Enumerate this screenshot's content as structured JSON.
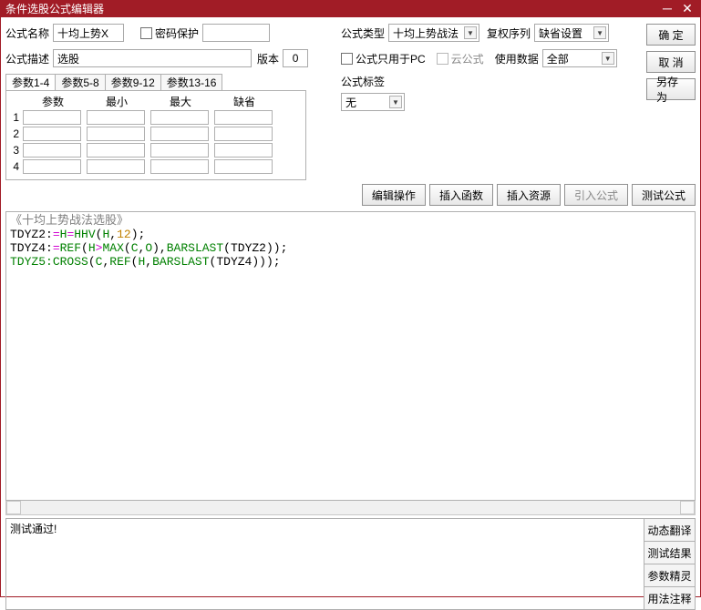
{
  "title": "条件选股公式编辑器",
  "labels": {
    "name": "公式名称",
    "pwd": "密码保护",
    "desc": "公式描述",
    "ver": "版本",
    "type": "公式类型",
    "fq": "复权序列",
    "pconly": "公式只用于PC",
    "cloud": "云公式",
    "usedata": "使用数据",
    "tag": "公式标签"
  },
  "vals": {
    "name": "十均上势X",
    "desc": "选股",
    "ver": "0",
    "type": "十均上势战法",
    "fq": "缺省设置",
    "usedata": "全部",
    "tag": "无"
  },
  "buttons": {
    "ok": "确  定",
    "cancel": "取  消",
    "saveas": "另存为",
    "editop": "编辑操作",
    "insfunc": "插入函数",
    "insres": "插入资源",
    "import": "引入公式",
    "test": "测试公式"
  },
  "ptabs": [
    "参数1-4",
    "参数5-8",
    "参数9-12",
    "参数13-16"
  ],
  "pheaders": [
    "参数",
    "最小",
    "最大",
    "缺省"
  ],
  "prows": [
    "1",
    "2",
    "3",
    "4"
  ],
  "code": {
    "header": "《十均上势战法选股》",
    "l1a": "TDYZ2:",
    "l1b": "=",
    "l1c": "H",
    "l1d": "=",
    "l1e": "HHV",
    "l1f": "(",
    "l1g": "H",
    "l1h": ",",
    "l1i": "12",
    "l1j": ");",
    "l2a": "TDYZ4:",
    "l2b": "=",
    "l2c": "REF",
    "l2d": "(",
    "l2e": "H",
    "l2f": ">",
    "l2g": "MAX",
    "l2h": "(",
    "l2i": "C",
    "l2j": ",",
    "l2k": "O",
    "l2l": "),",
    "l2m": "BARSLAST",
    "l2n": "(",
    "l2o": "TDYZ2));",
    "l3a": "TDYZ5:",
    "l3b": "CROSS",
    "l3c": "(",
    "l3d": "C",
    "l3e": ",",
    "l3f": "REF",
    "l3g": "(",
    "l3h": "H",
    "l3i": ",",
    "l3j": "BARSLAST",
    "l3k": "(",
    "l3l": "TDYZ4)));"
  },
  "msg": "测试通过!",
  "sidetabs": [
    "动态翻译",
    "测试结果",
    "参数精灵",
    "用法注释"
  ]
}
